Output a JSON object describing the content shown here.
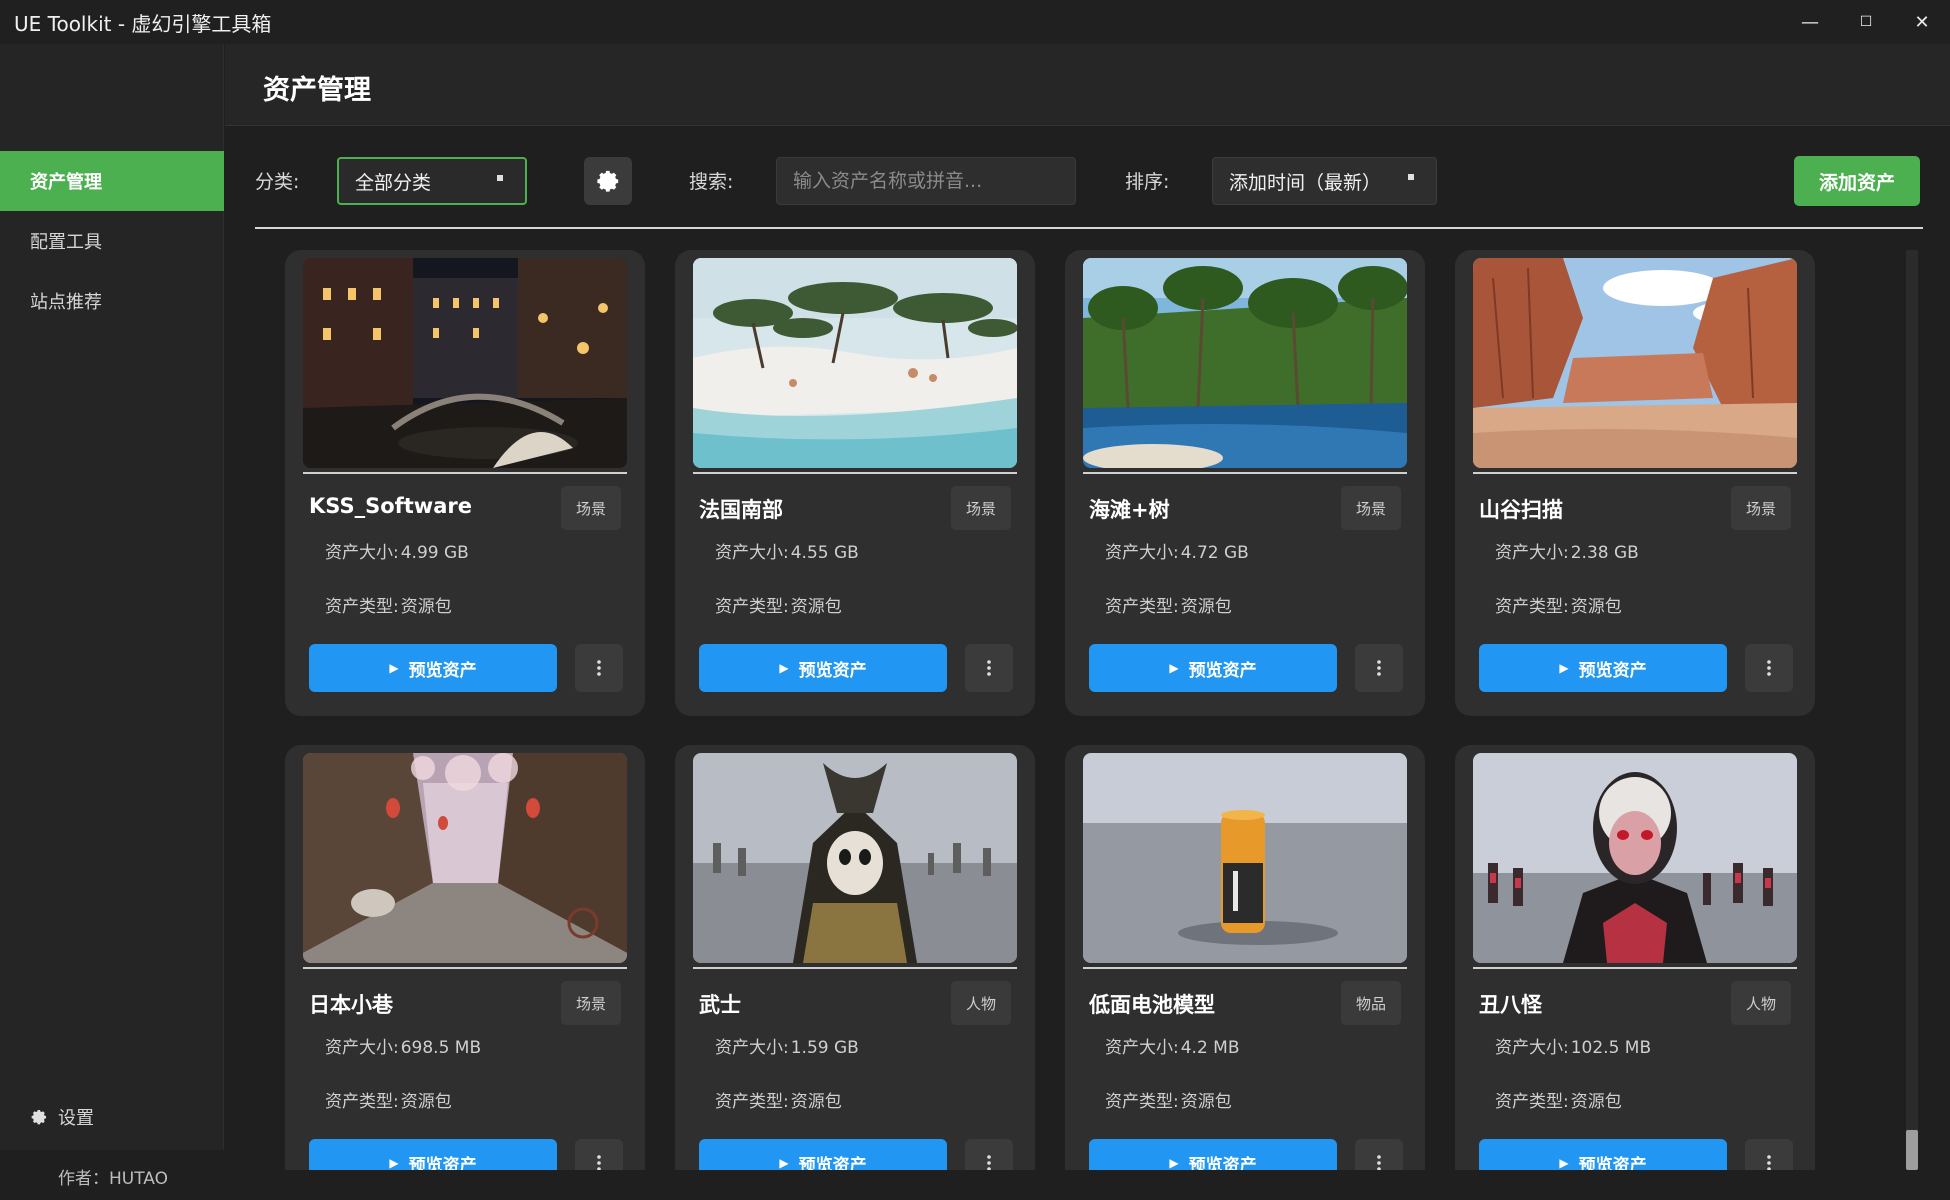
{
  "window": {
    "title": "UE Toolkit - 虚幻引擎工具箱",
    "minimize": "—",
    "maximize": "☐",
    "close": "✕"
  },
  "sidebar": {
    "items": [
      {
        "label": "资产管理",
        "active": true
      },
      {
        "label": "配置工具",
        "active": false
      },
      {
        "label": "站点推荐",
        "active": false
      }
    ],
    "settings_label": "设置",
    "author": "作者：HUTAO"
  },
  "header": {
    "title": "资产管理"
  },
  "toolbar": {
    "category_label": "分类:",
    "category_value": "全部分类",
    "search_label": "搜索:",
    "search_placeholder": "输入资产名称或拼音...",
    "sort_label": "排序:",
    "sort_value": "添加时间（最新）",
    "add_label": "添加资产"
  },
  "labels": {
    "size": "资产大小:",
    "type": "资产类型:",
    "preview": "预览资产"
  },
  "assets": [
    {
      "name": "KSS_Software",
      "tag": "场景",
      "size": "4.99 GB",
      "type": "资源包"
    },
    {
      "name": "法国南部",
      "tag": "场景",
      "size": "4.55 GB",
      "type": "资源包"
    },
    {
      "name": "海滩+树",
      "tag": "场景",
      "size": "4.72 GB",
      "type": "资源包"
    },
    {
      "name": "山谷扫描",
      "tag": "场景",
      "size": "2.38 GB",
      "type": "资源包"
    },
    {
      "name": "日本小巷",
      "tag": "场景",
      "size": "698.5 MB",
      "type": "资源包"
    },
    {
      "name": "武士",
      "tag": "人物",
      "size": "1.59 GB",
      "type": "资源包"
    },
    {
      "name": "低面电池模型",
      "tag": "物品",
      "size": "4.2 MB",
      "type": "资源包"
    },
    {
      "name": "丑八怪",
      "tag": "人物",
      "size": "102.5 MB",
      "type": "资源包"
    }
  ],
  "colors": {
    "accent_green": "#4caf50",
    "preview_blue": "#2196f3"
  }
}
